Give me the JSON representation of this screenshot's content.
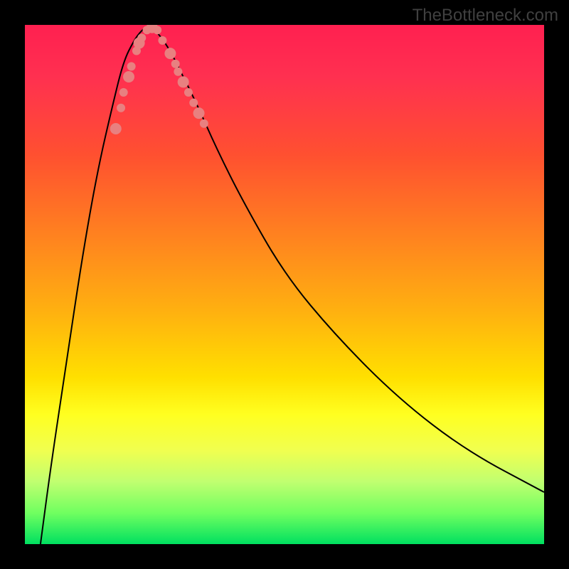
{
  "watermark": "TheBottleneck.com",
  "chart_data": {
    "type": "line",
    "title": "",
    "xlabel": "",
    "ylabel": "",
    "description": "V-shaped bottleneck curve over red-to-green gradient background. Minimum at approximately x=0.24 (normalized). Left branch descends steeply from top-left, right branch ascends with diminishing slope toward top-right.",
    "series": [
      {
        "name": "curve",
        "x_normalized": [
          0.03,
          0.05,
          0.08,
          0.11,
          0.14,
          0.17,
          0.19,
          0.21,
          0.225,
          0.24,
          0.26,
          0.28,
          0.3,
          0.33,
          0.37,
          0.42,
          0.5,
          0.6,
          0.72,
          0.85,
          1.0
        ],
        "y_normalized": [
          0.0,
          0.15,
          0.35,
          0.55,
          0.72,
          0.85,
          0.93,
          0.97,
          0.99,
          1.0,
          0.98,
          0.95,
          0.91,
          0.85,
          0.76,
          0.66,
          0.52,
          0.4,
          0.28,
          0.18,
          0.1
        ]
      }
    ],
    "data_points": {
      "name": "highlighted-points",
      "description": "Salmon-colored markers clustered near the V minimum on both branches",
      "points_normalized": [
        {
          "x": 0.175,
          "y": 0.8
        },
        {
          "x": 0.185,
          "y": 0.84
        },
        {
          "x": 0.19,
          "y": 0.87
        },
        {
          "x": 0.2,
          "y": 0.9
        },
        {
          "x": 0.205,
          "y": 0.92
        },
        {
          "x": 0.215,
          "y": 0.95
        },
        {
          "x": 0.22,
          "y": 0.965
        },
        {
          "x": 0.225,
          "y": 0.975
        },
        {
          "x": 0.235,
          "y": 0.99
        },
        {
          "x": 0.245,
          "y": 0.995
        },
        {
          "x": 0.255,
          "y": 0.99
        },
        {
          "x": 0.265,
          "y": 0.97
        },
        {
          "x": 0.28,
          "y": 0.945
        },
        {
          "x": 0.29,
          "y": 0.925
        },
        {
          "x": 0.295,
          "y": 0.91
        },
        {
          "x": 0.305,
          "y": 0.89
        },
        {
          "x": 0.315,
          "y": 0.87
        },
        {
          "x": 0.325,
          "y": 0.85
        },
        {
          "x": 0.335,
          "y": 0.83
        },
        {
          "x": 0.345,
          "y": 0.81
        }
      ]
    },
    "gradient_colors": {
      "top": "#ff2050",
      "mid": "#ffe000",
      "bottom": "#00e060"
    }
  }
}
